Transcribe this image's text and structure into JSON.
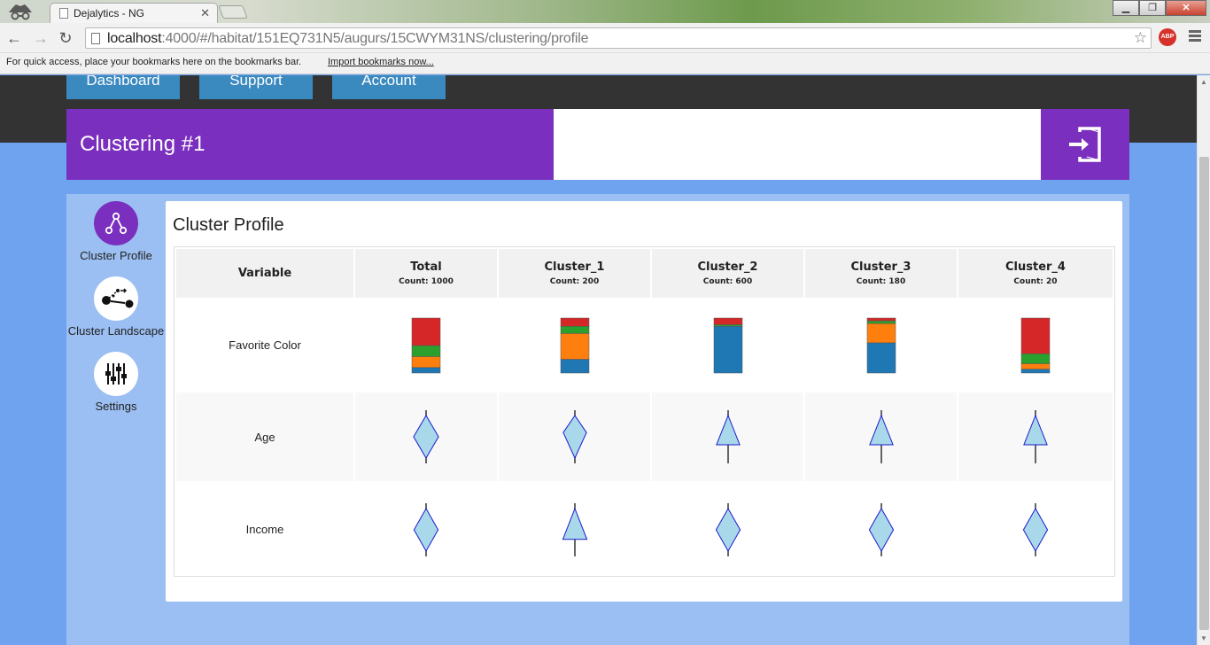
{
  "browser": {
    "tab_title": "Dejalytics - NG",
    "url_host": "localhost",
    "url_rest": ":4000/#/habitat/151EQ731N5/augurs/15CWYM31NS/clustering/profile",
    "abp_label": "ABP",
    "bookmarks_message": "For quick access, place your bookmarks here on the bookmarks bar.",
    "bookmarks_link": "Import bookmarks now..."
  },
  "nav": [
    "Dashboard",
    "Support",
    "Account"
  ],
  "header": {
    "title": "Clustering #1"
  },
  "sidebar": [
    {
      "label": "Cluster Profile",
      "icon": "cluster-profile-icon",
      "active": true
    },
    {
      "label": "Cluster Landscape",
      "icon": "cluster-landscape-icon",
      "active": false
    },
    {
      "label": "Settings",
      "icon": "settings-sliders-icon",
      "active": false
    }
  ],
  "profile": {
    "title": "Cluster Profile",
    "variable_header": "Variable",
    "columns": [
      {
        "name": "Total",
        "count": "Count: 1000"
      },
      {
        "name": "Cluster_1",
        "count": "Count: 200"
      },
      {
        "name": "Cluster_2",
        "count": "Count: 600"
      },
      {
        "name": "Cluster_3",
        "count": "Count: 180"
      },
      {
        "name": "Cluster_4",
        "count": "Count: 20"
      }
    ],
    "rows": [
      "Favorite Color",
      "Age",
      "Income"
    ]
  },
  "chart_data": {
    "type": "bar",
    "title": "",
    "xlabel": "",
    "ylabel": "",
    "ylim": [
      0,
      1
    ],
    "categories": [
      "Total",
      "Cluster_1",
      "Cluster_2",
      "Cluster_3",
      "Cluster_4"
    ],
    "series": [
      {
        "color": "#1f77b4",
        "values": [
          0.1,
          0.25,
          0.85,
          0.55,
          0.07
        ]
      },
      {
        "color": "#ff7f0e",
        "values": [
          0.2,
          0.47,
          0.0,
          0.35,
          0.1
        ]
      },
      {
        "color": "#2ca02c",
        "values": [
          0.2,
          0.13,
          0.03,
          0.05,
          0.18
        ]
      },
      {
        "color": "#d62728",
        "values": [
          0.5,
          0.15,
          0.12,
          0.05,
          0.65
        ]
      }
    ],
    "distributions": {
      "Age": [
        {
          "min": 0.0,
          "max": 1.0,
          "mode": 0.5,
          "width": 0.88,
          "shape": "diamond"
        },
        {
          "min": 0.0,
          "max": 1.0,
          "mode": 0.42,
          "width": 0.82,
          "shape": "diamond"
        },
        {
          "min": 0.0,
          "max": 1.0,
          "mode": 0.65,
          "width": 0.82,
          "shape": "triangle"
        },
        {
          "min": 0.0,
          "max": 1.0,
          "mode": 0.65,
          "width": 0.82,
          "shape": "triangle"
        },
        {
          "min": 0.0,
          "max": 1.0,
          "mode": 0.65,
          "width": 0.82,
          "shape": "triangle"
        }
      ],
      "Income": [
        {
          "min": 0.0,
          "max": 1.0,
          "mode": 0.5,
          "width": 0.85,
          "shape": "diamond"
        },
        {
          "min": 0.0,
          "max": 1.0,
          "mode": 0.68,
          "width": 0.85,
          "shape": "triangle"
        },
        {
          "min": 0.0,
          "max": 1.0,
          "mode": 0.5,
          "width": 0.85,
          "shape": "diamond"
        },
        {
          "min": 0.0,
          "max": 1.0,
          "mode": 0.5,
          "width": 0.85,
          "shape": "diamond"
        },
        {
          "min": 0.0,
          "max": 1.0,
          "mode": 0.5,
          "width": 0.85,
          "shape": "diamond"
        }
      ]
    },
    "distribution_fill": "#a8d8ea",
    "distribution_stroke": "#1a1acc"
  }
}
